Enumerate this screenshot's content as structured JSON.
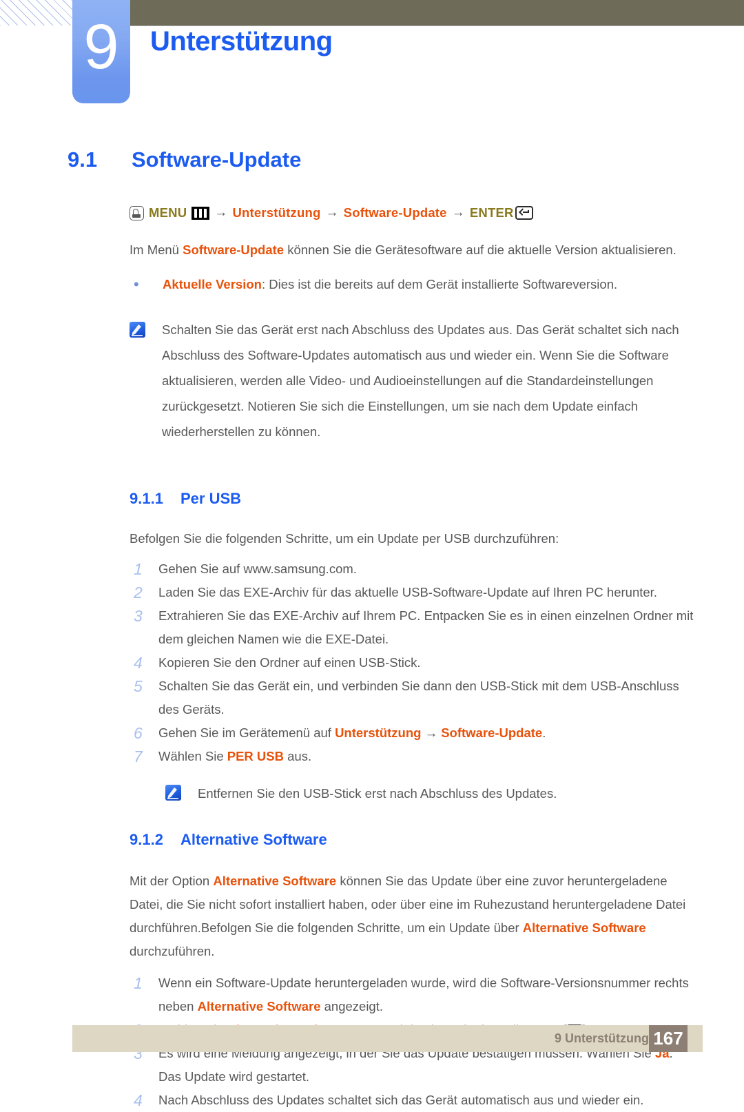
{
  "header": {
    "chapter_number": "9",
    "chapter_title": "Unterstützung"
  },
  "section": {
    "number": "9.1",
    "title": "Software-Update"
  },
  "menu_path": {
    "hand_icon": "hand-press-icon",
    "menu_label": "MENU",
    "menubars_icon": "menu-bars-icon",
    "arrow": "→",
    "item1": "Unterstützung",
    "item2": "Software-Update",
    "enter_label": "ENTER",
    "enter_icon": "enter-key-icon"
  },
  "intro": {
    "part1": "Im Menü ",
    "highlight": "Software-Update",
    "part2": " können Sie die Gerätesoftware auf die aktuelle Version aktualisieren."
  },
  "bullet": {
    "marker": "•",
    "highlight": "Aktuelle Version",
    "text": ": Dies ist die bereits auf dem Gerät installierte Softwareversion."
  },
  "note1": {
    "icon": "note-pencil-icon",
    "text": "Schalten Sie das Gerät erst nach Abschluss des Updates aus. Das Gerät schaltet sich nach Abschluss des Software-Updates automatisch aus und wieder ein. Wenn Sie die Software aktualisieren, werden alle Video- und Audioeinstellungen auf die Standardeinstellungen zurückgesetzt. Notieren Sie sich die Einstellungen, um sie nach dem Update einfach wiederherstellen zu können."
  },
  "subsection_1": {
    "number": "9.1.1",
    "title": "Per USB",
    "intro": "Befolgen Sie die folgenden Schritte, um ein Update per USB durchzuführen:",
    "steps": [
      {
        "n": "1",
        "text": "Gehen Sie auf www.samsung.com."
      },
      {
        "n": "2",
        "text": "Laden Sie das EXE-Archiv für das aktuelle USB-Software-Update auf Ihren PC herunter."
      },
      {
        "n": "3",
        "text": "Extrahieren Sie das EXE-Archiv auf Ihrem PC. Entpacken Sie es in einen einzelnen Ordner mit dem gleichen Namen wie die EXE-Datei."
      },
      {
        "n": "4",
        "text": "Kopieren Sie den Ordner auf einen USB-Stick."
      },
      {
        "n": "5",
        "text": "Schalten Sie das Gerät ein, und verbinden Sie dann den USB-Stick mit dem USB-Anschluss des Geräts."
      },
      {
        "n": "6",
        "text_pre": "Gehen Sie im Gerätemenü auf ",
        "hl1": "Unterstützung",
        "mid": " → ",
        "hl2": "Software-Update",
        "text_post": "."
      },
      {
        "n": "7",
        "text_pre": "Wählen Sie ",
        "hl1": "PER USB",
        "text_post": " aus."
      }
    ],
    "note": {
      "icon": "note-pencil-icon",
      "text": "Entfernen Sie den USB-Stick erst nach Abschluss des Updates."
    }
  },
  "subsection_2": {
    "number": "9.1.2",
    "title": "Alternative Software",
    "para_a_pre": "Mit der Option ",
    "para_a_hl": "Alternative Software",
    "para_a_post": " können Sie das Update über eine zuvor heruntergeladene Datei, die Sie nicht sofort installiert haben, oder über eine im Ruhezustand heruntergeladene Datei durchführen.",
    "para_b_pre": "Befolgen Sie die folgenden Schritte, um ein Update über ",
    "para_b_hl": "Alternative Software",
    "para_b_post": " durchzuführen.",
    "steps": [
      {
        "n": "1",
        "pre": "Wenn ein Software-Update heruntergeladen wurde, wird die Software-Versionsnummer rechts neben ",
        "hl": "Alternative Software",
        "post": " angezeigt."
      },
      {
        "n": "2",
        "pre": "Wählen Sie ",
        "hl": "Alternative Software",
        "post": " aus, und drücken Sie dann die Taste [",
        "icon": "enter-key-icon",
        "tail": "]."
      },
      {
        "n": "3",
        "pre": "Es wird eine Meldung angezeigt, in der Sie das Update bestätigen müssen. Wählen Sie ",
        "hl": "Ja",
        "post": ". Das Update wird gestartet."
      },
      {
        "n": "4",
        "pre": "Nach Abschluss des Updates schaltet sich das Gerät automatisch aus und wieder ein.",
        "hl": "",
        "post": ""
      }
    ]
  },
  "footer": {
    "label": "9 Unterstützung",
    "page": "167"
  },
  "colors": {
    "heading_blue": "#1b5bf0",
    "highlight_orange": "#e8520b",
    "menu_olive": "#8a7a1e",
    "body_gray": "#58585a",
    "header_bar": "#6e6c58",
    "footer_bar": "#ddd7c3",
    "footer_page_box": "#8d7f74"
  }
}
